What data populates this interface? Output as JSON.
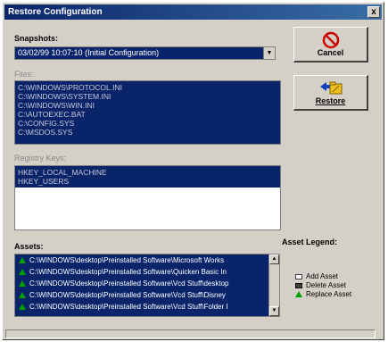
{
  "window": {
    "title": "Restore Configuration",
    "close_glyph": "x"
  },
  "snapshots": {
    "label": "Snapshots:",
    "selected": "03/02/99 10:07:10 (Initial Configuration)"
  },
  "files": {
    "label": "Files:",
    "items": [
      "C:\\WINDOWS\\PROTOCOL.INI",
      "C:\\WINDOWS\\SYSTEM.INI",
      "C:\\WINDOWS\\WIN.INI",
      "C:\\AUTOEXEC.BAT",
      "C:\\CONFIG.SYS",
      "C:\\MSDOS.SYS"
    ]
  },
  "registry": {
    "label": "Registry Keys:",
    "items": [
      "HKEY_LOCAL_MACHINE",
      "HKEY_USERS"
    ]
  },
  "buttons": {
    "cancel": "Cancel",
    "restore": "Restore"
  },
  "assets": {
    "label": "Assets:",
    "items": [
      "C:\\WINDOWS\\desktop\\Preinstalled Software\\Microsoft Works",
      "C:\\WINDOWS\\desktop\\Preinstalled Software\\Quicken Basic In",
      "C:\\WINDOWS\\desktop\\Preinstalled Software\\Vcd Stuff\\desktop",
      "C:\\WINDOWS\\desktop\\Preinstalled Software\\Vcd Stuff\\Disney",
      "C:\\WINDOWS\\desktop\\Preinstalled Software\\Vcd Stuff\\Folder I"
    ]
  },
  "legend": {
    "label": "Asset Legend:",
    "items": [
      {
        "label": "Add Asset",
        "icon": "add-asset-icon"
      },
      {
        "label": "Delete Asset",
        "icon": "delete-asset-icon"
      },
      {
        "label": "Replace Asset",
        "icon": "replace-asset-icon"
      }
    ]
  },
  "colors": {
    "selection": "#0a246a",
    "face": "#d4d0c8",
    "cancel_icon": "#cc0000",
    "replace_icon": "#00a000"
  }
}
